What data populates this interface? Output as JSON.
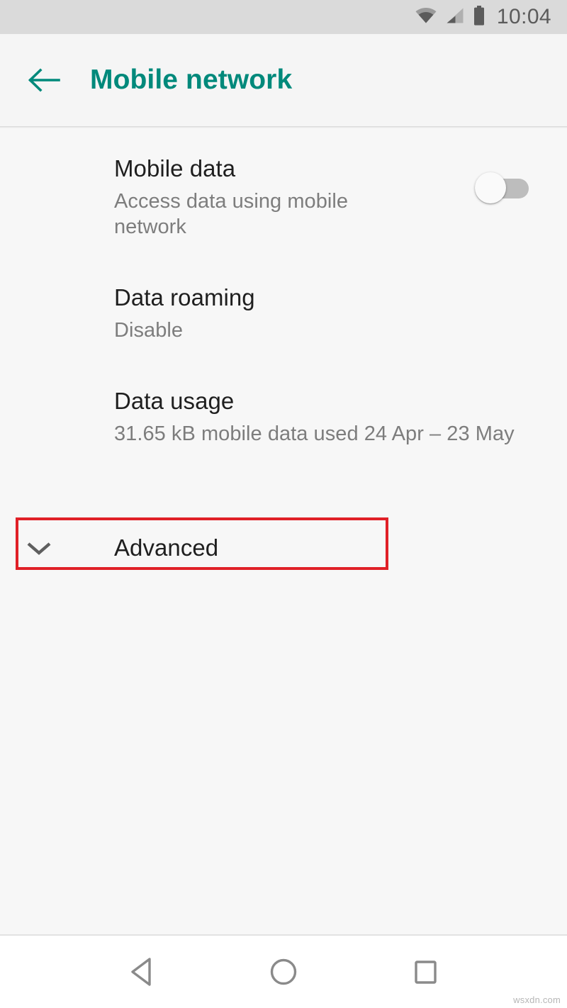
{
  "status_bar": {
    "time": "10:04",
    "icons": [
      "wifi-icon",
      "cellular-signal-icon",
      "battery-icon"
    ],
    "background": "#dadada"
  },
  "app_bar": {
    "back_label": "back-arrow",
    "title": "Mobile network",
    "title_color": "#00897b",
    "background": "#f5f5f5"
  },
  "settings": {
    "rows": [
      {
        "title": "Mobile data",
        "summary": "Access data using mobile network",
        "has_toggle": true,
        "toggle_state": "off"
      },
      {
        "title": "Data roaming",
        "summary": "Disable",
        "has_toggle": false
      },
      {
        "title": "Data usage",
        "summary": "31.65 kB mobile data used 24 Apr – 23 May",
        "has_toggle": false
      }
    ],
    "advanced": {
      "label": "Advanced",
      "icon": "chevron-down-icon",
      "expanded": false
    }
  },
  "annotation": {
    "type": "rectangle-highlight",
    "color": "#e02027",
    "target": "Advanced"
  },
  "nav_bar": {
    "buttons": [
      {
        "name": "back",
        "icon": "triangle-left-icon"
      },
      {
        "name": "home",
        "icon": "circle-icon"
      },
      {
        "name": "recents",
        "icon": "square-icon"
      }
    ],
    "background": "#ffffff",
    "icon_color": "#8a8a8a"
  },
  "watermark": {
    "text": "wsxdn.com"
  }
}
